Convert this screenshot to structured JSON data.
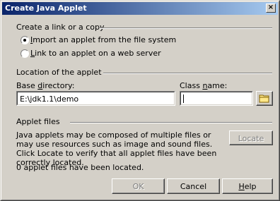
{
  "window": {
    "title": "Create Java Applet",
    "close_glyph": "×"
  },
  "link_section": {
    "label": "Create a link or a copy",
    "options": [
      {
        "label_underline": "I",
        "label_rest": "mport an applet from the file system",
        "selected": true
      },
      {
        "label_underline": "L",
        "label_rest": "ink to an applet on a web server",
        "selected": false
      }
    ]
  },
  "location_section": {
    "label": "Location of the applet",
    "base_dir_label_pre": "Base ",
    "base_dir_label_underline": "d",
    "base_dir_label_post": "irectory:",
    "base_dir_value": "E:\\jdk1.1\\demo",
    "class_name_label_pre": "Class ",
    "class_name_label_underline": "n",
    "class_name_label_post": "ame:",
    "class_name_value": "",
    "browse_icon": "folder-icon"
  },
  "files_section": {
    "label": "Applet files",
    "description": "Java applets may be composed of multiple files or may use resources such as image and sound files. Click Locate to verify that all applet files have been correctly located.",
    "status": "0 applet files have been located.",
    "locate_label": "Locate"
  },
  "buttons": {
    "ok_label": "OK",
    "cancel_label": "Cancel",
    "help_label_underline": "H",
    "help_label_rest": "elp"
  }
}
